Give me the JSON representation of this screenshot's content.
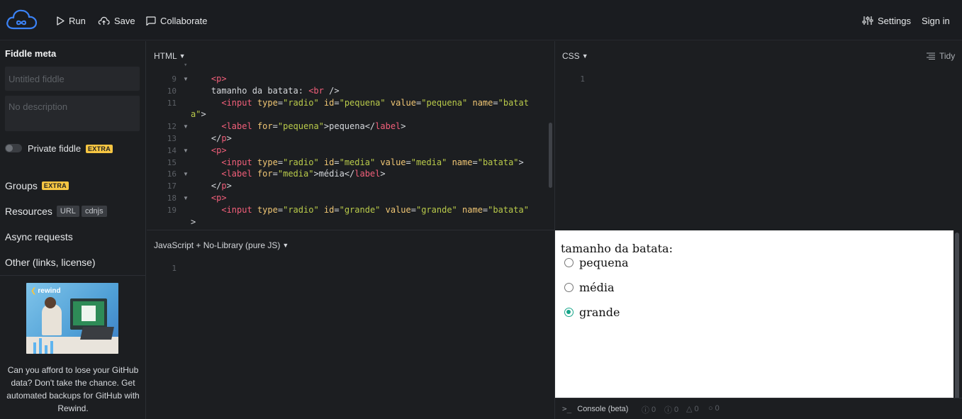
{
  "topbar": {
    "run_label": "Run",
    "save_label": "Save",
    "collaborate_label": "Collaborate",
    "settings_label": "Settings",
    "signin_label": "Sign in"
  },
  "sidebar": {
    "title": "Fiddle meta",
    "title_placeholder": "Untitled fiddle",
    "description_placeholder": "No description",
    "private_label": "Private fiddle",
    "extra_badge": "EXTRA",
    "groups_label": "Groups",
    "resources_label": "Resources",
    "url_badge": "URL",
    "cdnjs_badge": "cdnjs",
    "async_label": "Async requests",
    "other_label": "Other (links, license)",
    "ad_brand": "rewind",
    "ad_text": "Can you afford to lose your GitHub data? Don't take the chance. Get automated backups for GitHub with Rewind."
  },
  "html_panel": {
    "label": "HTML",
    "lines": [
      {
        "num": "9",
        "fold": true,
        "indent": "    ",
        "tokens": [
          [
            "tag",
            "<p>"
          ]
        ]
      },
      {
        "num": "10",
        "fold": false,
        "indent": "    ",
        "tokens": [
          [
            "punc",
            "tamanho da batata: "
          ],
          [
            "tag",
            "<br"
          ],
          [
            "punc",
            " />"
          ]
        ]
      },
      {
        "num": "11",
        "fold": false,
        "indent": "      ",
        "tokens": [
          [
            "tag",
            "<input"
          ],
          [
            "punc",
            " "
          ],
          [
            "attr",
            "type"
          ],
          [
            "punc",
            "="
          ],
          [
            "str",
            "\"radio\""
          ],
          [
            "punc",
            " "
          ],
          [
            "attr",
            "id"
          ],
          [
            "punc",
            "="
          ],
          [
            "str",
            "\"pequena\""
          ],
          [
            "punc",
            " "
          ],
          [
            "attr",
            "value"
          ],
          [
            "punc",
            "="
          ],
          [
            "str",
            "\"pequena\""
          ],
          [
            "punc",
            " "
          ],
          [
            "attr",
            "name"
          ],
          [
            "punc",
            "="
          ],
          [
            "str",
            "\"batat"
          ]
        ]
      },
      {
        "num": "",
        "fold": false,
        "indent": "",
        "tokens": [
          [
            "str",
            "a\""
          ],
          [
            "punc",
            ">"
          ]
        ]
      },
      {
        "num": "12",
        "fold": true,
        "indent": "      ",
        "tokens": [
          [
            "tag",
            "<label"
          ],
          [
            "punc",
            " "
          ],
          [
            "attr",
            "for"
          ],
          [
            "punc",
            "="
          ],
          [
            "str",
            "\"pequena\""
          ],
          [
            "punc",
            ">pequena</"
          ],
          [
            "tag",
            "label"
          ],
          [
            "punc",
            ">"
          ]
        ]
      },
      {
        "num": "13",
        "fold": false,
        "indent": "    ",
        "tokens": [
          [
            "punc",
            "</"
          ],
          [
            "tag",
            "p"
          ],
          [
            "punc",
            ">"
          ]
        ]
      },
      {
        "num": "14",
        "fold": true,
        "indent": "    ",
        "tokens": [
          [
            "tag",
            "<p>"
          ]
        ]
      },
      {
        "num": "15",
        "fold": false,
        "indent": "      ",
        "tokens": [
          [
            "tag",
            "<input"
          ],
          [
            "punc",
            " "
          ],
          [
            "attr",
            "type"
          ],
          [
            "punc",
            "="
          ],
          [
            "str",
            "\"radio\""
          ],
          [
            "punc",
            " "
          ],
          [
            "attr",
            "id"
          ],
          [
            "punc",
            "="
          ],
          [
            "str",
            "\"media\""
          ],
          [
            "punc",
            " "
          ],
          [
            "attr",
            "value"
          ],
          [
            "punc",
            "="
          ],
          [
            "str",
            "\"media\""
          ],
          [
            "punc",
            " "
          ],
          [
            "attr",
            "name"
          ],
          [
            "punc",
            "="
          ],
          [
            "str",
            "\"batata\""
          ],
          [
            "punc",
            ">"
          ]
        ]
      },
      {
        "num": "16",
        "fold": true,
        "indent": "      ",
        "tokens": [
          [
            "tag",
            "<label"
          ],
          [
            "punc",
            " "
          ],
          [
            "attr",
            "for"
          ],
          [
            "punc",
            "="
          ],
          [
            "str",
            "\"media\""
          ],
          [
            "punc",
            ">média</"
          ],
          [
            "tag",
            "label"
          ],
          [
            "punc",
            ">"
          ]
        ]
      },
      {
        "num": "17",
        "fold": false,
        "indent": "    ",
        "tokens": [
          [
            "punc",
            "</"
          ],
          [
            "tag",
            "p"
          ],
          [
            "punc",
            ">"
          ]
        ]
      },
      {
        "num": "18",
        "fold": true,
        "indent": "    ",
        "tokens": [
          [
            "tag",
            "<p>"
          ]
        ]
      },
      {
        "num": "19",
        "fold": false,
        "indent": "      ",
        "tokens": [
          [
            "tag",
            "<input"
          ],
          [
            "punc",
            " "
          ],
          [
            "attr",
            "type"
          ],
          [
            "punc",
            "="
          ],
          [
            "str",
            "\"radio\""
          ],
          [
            "punc",
            " "
          ],
          [
            "attr",
            "id"
          ],
          [
            "punc",
            "="
          ],
          [
            "str",
            "\"grande\""
          ],
          [
            "punc",
            " "
          ],
          [
            "attr",
            "value"
          ],
          [
            "punc",
            "="
          ],
          [
            "str",
            "\"grande\""
          ],
          [
            "punc",
            " "
          ],
          [
            "attr",
            "name"
          ],
          [
            "punc",
            "="
          ],
          [
            "str",
            "\"batata\""
          ]
        ]
      },
      {
        "num": "",
        "fold": false,
        "indent": "",
        "tokens": [
          [
            "punc",
            ">"
          ]
        ]
      }
    ]
  },
  "css_panel": {
    "label": "CSS",
    "tidy_label": "Tidy",
    "line_num": "1"
  },
  "js_panel": {
    "label": "JavaScript + No-Library (pure JS)",
    "line_num": "1"
  },
  "result": {
    "text": "tamanho da batata:",
    "options": [
      {
        "label": "pequena",
        "checked": false
      },
      {
        "label": "média",
        "checked": false
      },
      {
        "label": "grande",
        "checked": true
      }
    ]
  },
  "console": {
    "label": "Console (beta)",
    "counts": [
      "0",
      "0",
      "0",
      "0"
    ]
  },
  "colors": {
    "accent": "#17a589",
    "extra_badge": "#f5c542",
    "background": "#1c1e21"
  }
}
